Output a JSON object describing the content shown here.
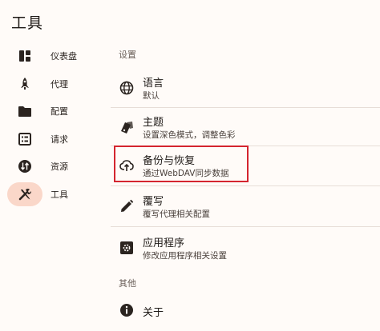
{
  "app": {
    "title": "工具"
  },
  "sidebar": {
    "items": [
      {
        "label": "仪表盘",
        "icon": "dashboard-icon"
      },
      {
        "label": "代理",
        "icon": "rocket-icon"
      },
      {
        "label": "配置",
        "icon": "folder-icon"
      },
      {
        "label": "请求",
        "icon": "list-icon"
      },
      {
        "label": "资源",
        "icon": "swap-vertical-icon"
      },
      {
        "label": "工具",
        "icon": "tools-icon",
        "active": true
      }
    ]
  },
  "main": {
    "section_settings": "设置",
    "section_other": "其他",
    "rows": [
      {
        "title": "语言",
        "subtitle": "默认",
        "icon": "globe-icon"
      },
      {
        "title": "主题",
        "subtitle": "设置深色模式，调整色彩",
        "icon": "palette-icon"
      },
      {
        "title": "备份与恢复",
        "subtitle": "通过WebDAV同步数据",
        "icon": "cloud-backup-icon"
      },
      {
        "title": "覆写",
        "subtitle": "覆写代理相关配置",
        "icon": "pencil-icon"
      },
      {
        "title": "应用程序",
        "subtitle": "修改应用程序相关设置",
        "icon": "settings-app-icon"
      },
      {
        "title": "关于",
        "subtitle": "",
        "icon": "info-icon"
      }
    ]
  },
  "colors": {
    "active_pill": "#fad7c9",
    "highlight_border": "#d4252f",
    "background": "#fffbf8"
  }
}
